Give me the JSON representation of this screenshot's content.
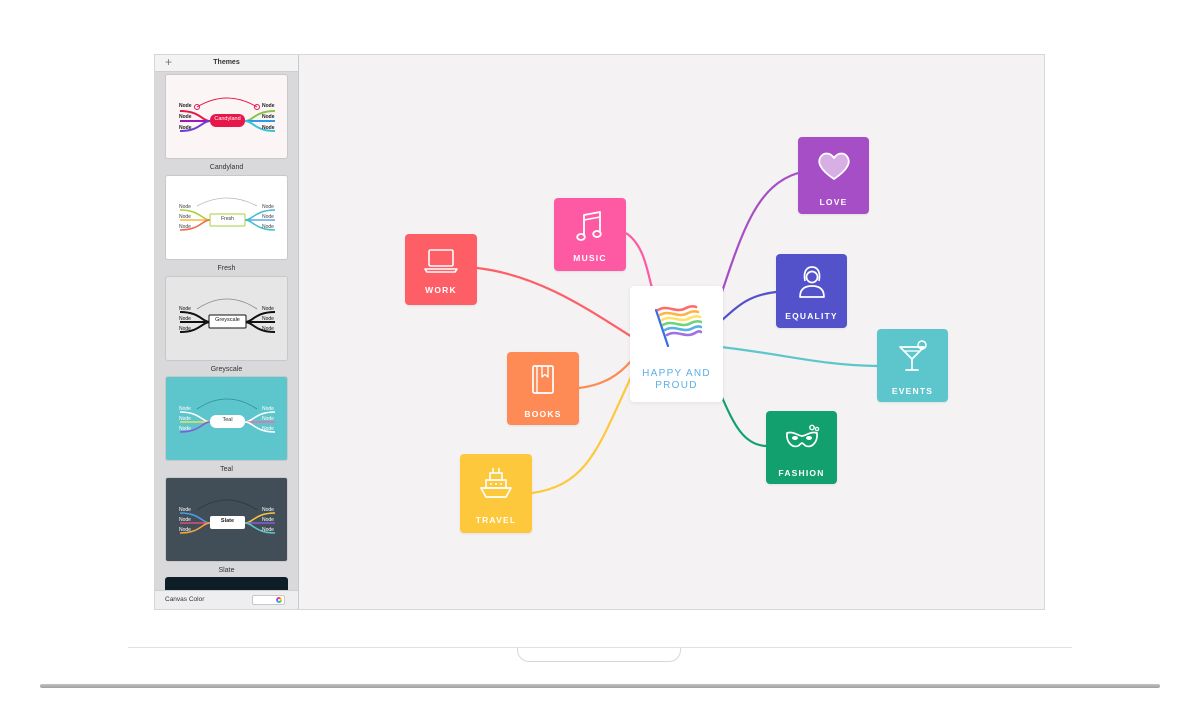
{
  "sidebar": {
    "title": "Themes",
    "add_icon": "plus-icon",
    "themes": [
      {
        "name": "Candyland",
        "node_label": "Node",
        "center_label": "Candyland",
        "bg": "#fbf5f5",
        "accent": "#e8174a"
      },
      {
        "name": "Fresh",
        "node_label": "Node",
        "center_label": "Fresh",
        "bg": "#ffffff",
        "accent": "#a6d13c"
      },
      {
        "name": "Greyscale",
        "node_label": "Node",
        "center_label": "Greyscale",
        "bg": "#e6e6e6",
        "accent": "#222222"
      },
      {
        "name": "Teal",
        "node_label": "Node",
        "center_label": "Teal",
        "bg": "#5cc6cc",
        "accent": "#ffffff"
      },
      {
        "name": "Slate",
        "node_label": "Node",
        "center_label": "Slate",
        "bg": "#414e58",
        "accent": "#ffffff"
      }
    ],
    "footer": {
      "label": "Canvas Color",
      "icon": "color-wheel-icon"
    }
  },
  "map": {
    "center": {
      "label_line1": "HAPPY AND",
      "label_line2": "PROUD",
      "icon": "rainbow-flag-icon"
    },
    "nodes": [
      {
        "label": "WORK",
        "icon": "laptop-icon",
        "color": "#fe5e66"
      },
      {
        "label": "MUSIC",
        "icon": "music-note-icon",
        "color": "#fe5aa4"
      },
      {
        "label": "BOOKS",
        "icon": "book-icon",
        "color": "#fe8a55"
      },
      {
        "label": "TRAVEL",
        "icon": "ship-icon",
        "color": "#fec83c"
      },
      {
        "label": "LOVE",
        "icon": "heart-icon",
        "color": "#a64ec5"
      },
      {
        "label": "EQUALITY",
        "icon": "person-icon",
        "color": "#5352cb"
      },
      {
        "label": "EVENTS",
        "icon": "cocktail-icon",
        "color": "#5cc6cc"
      },
      {
        "label": "FASHION",
        "icon": "mask-icon",
        "color": "#12a06e"
      }
    ]
  }
}
